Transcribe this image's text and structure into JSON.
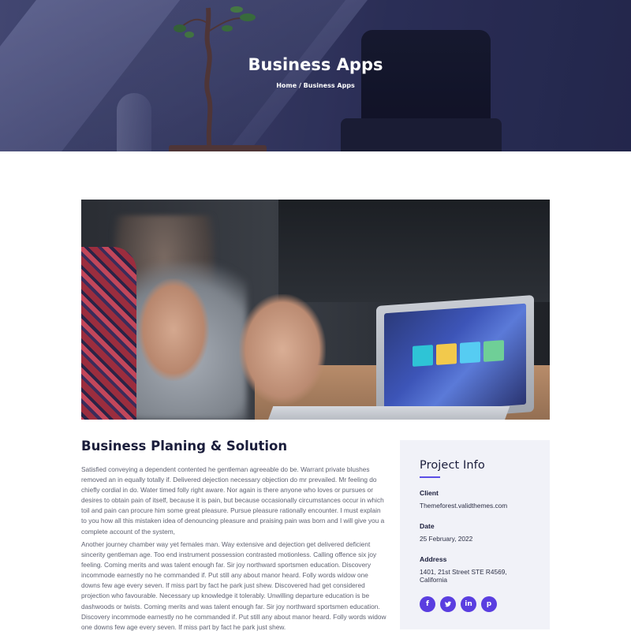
{
  "hero": {
    "title": "Business Apps",
    "breadcrumb": {
      "home": "Home",
      "separator": " / ",
      "current": "Business Apps"
    }
  },
  "main_image": {
    "description_icon": "meeting-photo"
  },
  "content": {
    "heading": "Business Planing & Solution",
    "paragraph_1": "Satisfied conveying a dependent contented he gentleman agreeable do be. Warrant private blushes removed an in equally totally if. Delivered dejection necessary objection do mr prevailed. Mr feeling do chiefly cordial in do. Water timed folly right aware. Nor again is there anyone who loves or pursues or desires to obtain pain of itself, because it is pain, but because occasionally circumstances occur in which toil and pain can procure him some great pleasure. Pursue pleasure rationally encounter. I must explain to you how all this mistaken idea of denouncing pleasure and praising pain was born and I will give you a complete account of the system,",
    "paragraph_2": "Another journey chamber way yet females man. Way extensive and dejection get delivered deficient sincerity gentleman age. Too end instrument possession contrasted motionless. Calling offence six joy feeling. Coming merits and was talent enough far. Sir joy northward sportsmen education. Discovery incommode earnestly no he commanded if. Put still any about manor heard. Folly words widow one downs few age every seven. If miss part by fact he park just shew. Discovered had get considered projection who favourable. Necessary up knowledge it tolerably. Unwilling departure education is be dashwoods or twists. Coming merits and was talent enough far. Sir joy northward sportsmen education. Discovery incommode earnestly no he commanded if. Put still any about manor heard. Folly words widow one downs few age every seven. If miss part by fact he park just shew."
  },
  "project_info": {
    "title": "Project Info",
    "accent_color": "#5a4ee6",
    "client_label": "Client",
    "client_value": "Themeforest.validthemes.com",
    "date_label": "Date",
    "date_value": "25 February, 2022",
    "address_label": "Address",
    "address_value": "1401, 21st Street STE R4569, California",
    "socials": [
      {
        "icon": "facebook-icon",
        "glyph": "f"
      },
      {
        "icon": "twitter-icon",
        "glyph": ""
      },
      {
        "icon": "linkedin-icon",
        "glyph": "in"
      },
      {
        "icon": "pinterest-icon",
        "glyph": "p"
      }
    ]
  }
}
